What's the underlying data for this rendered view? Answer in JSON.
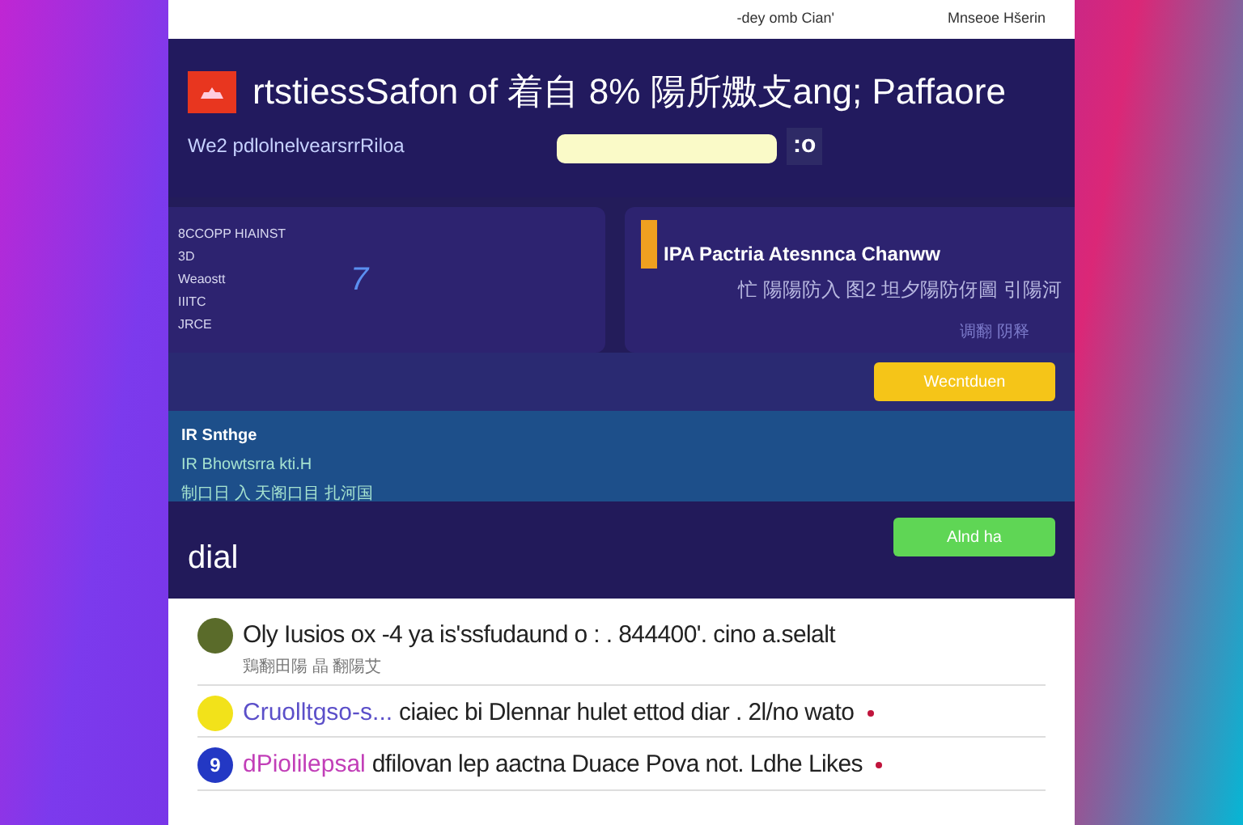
{
  "top_bar": {
    "links": [
      "-dey omb Cian'",
      "Mnseoe Hšerin"
    ]
  },
  "header": {
    "title": "rtstiessSafon of 着自 8% 陽所嫐攴ang; Paffaore",
    "subtitle": "We2 pdlolnelvearsrrRiloa",
    "action": ":o"
  },
  "cards": [
    {
      "kind": "stats",
      "lines": [
        "8CCOPP HIAINST",
        "3D",
        "Weaostt",
        "IIITC",
        "JRCE"
      ],
      "value": "7"
    },
    {
      "kind": "feature",
      "title": "IPA Pactria Atesnnca Chanww",
      "subtitle": "忙 陽陽防入 图2 坦夕陽防伢圖 引陽河",
      "note": "调翻 阴释"
    }
  ],
  "primary_button": "Wecntduen",
  "banner": {
    "title": "IR Snthge",
    "lines": [
      "IR Bhowtsrra kti.H",
      "制口日 入 天阁口目 扎河国"
    ]
  },
  "section": {
    "title": "dial",
    "button": "Alnd ha"
  },
  "feed": [
    {
      "avatar": {
        "color": "#5a6b2a"
      },
      "text": "Oly Iusios ox -4 ya is'ssfudaund o : . 844400'. cino a.selalt",
      "meta": "鶏翻田陽 晶 翻陽艾",
      "unread": false
    },
    {
      "avatar": {
        "color": "#f2e21a"
      },
      "tag": {
        "text": "Cruolltgso-s...",
        "color": "#5b4fc9"
      },
      "text": "ciaiec bi Dlennar hulet ettod diar . 2l/no wato",
      "unread": true
    },
    {
      "avatar": {
        "color": "#2338c4",
        "text": "9"
      },
      "tag": {
        "text": "dPiolilepsal",
        "color": "#c23fb8"
      },
      "text": "dfilovan lep aactna Duace Pova not.  Ldhe Likes",
      "unread": true
    }
  ]
}
